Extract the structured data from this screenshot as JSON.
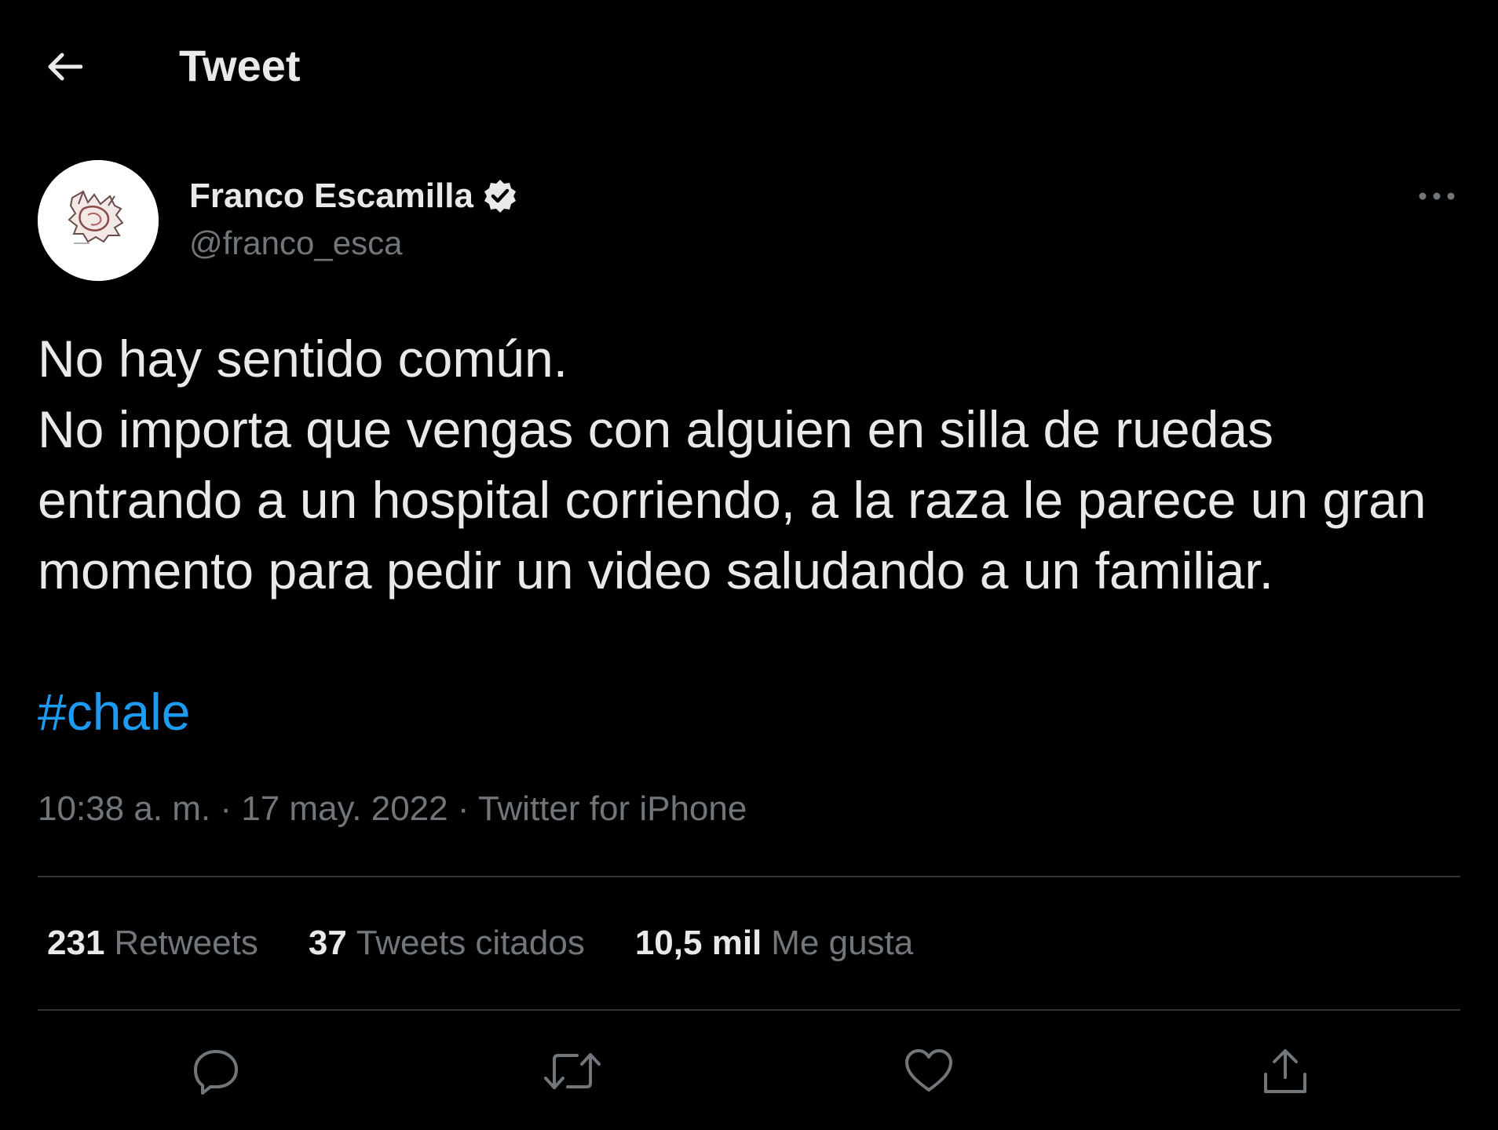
{
  "header": {
    "title": "Tweet",
    "back_icon": "arrow-left-icon"
  },
  "author": {
    "display_name": "Franco Escamilla",
    "handle": "@franco_esca",
    "verified_icon": "verified-badge-icon",
    "more_icon": "more-horizontal-icon"
  },
  "tweet": {
    "text": "No hay sentido común.\nNo importa que vengas con alguien en silla de ruedas entrando a un hospital corriendo, a la raza le parece un gran momento para pedir un video saludando a un familiar.",
    "hashtag": "#chale",
    "time": "10:38 a. m.",
    "separator": "·",
    "date": "17 may. 2022",
    "source": "Twitter for iPhone"
  },
  "stats": {
    "retweets_count": "231",
    "retweets_label": "Retweets",
    "quotes_count": "37",
    "quotes_label": "Tweets citados",
    "likes_count": "10,5 mil",
    "likes_label": "Me gusta"
  },
  "actions": {
    "reply_icon": "reply-icon",
    "retweet_icon": "retweet-icon",
    "like_icon": "heart-icon",
    "share_icon": "share-icon"
  },
  "colors": {
    "background": "#000000",
    "text_primary": "#e7e9ea",
    "text_secondary": "#71767b",
    "link": "#1d9bf0",
    "divider": "#2f3336"
  }
}
